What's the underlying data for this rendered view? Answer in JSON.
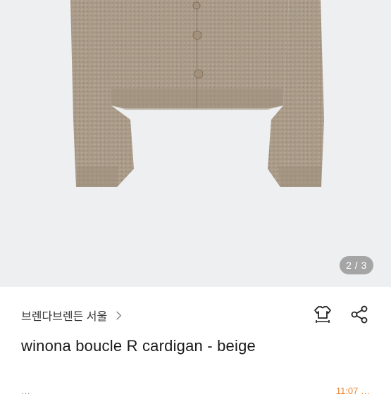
{
  "product_image": {
    "alt_icon": "beige-boucle-cardigan-photo",
    "background_color": "#eeeff0",
    "garment_color": "#a89886"
  },
  "image_counter": {
    "current": "2",
    "separator": "/",
    "total": "3",
    "text": "2 / 3"
  },
  "product": {
    "brand": "브렌다브렌든 서울",
    "title": "winona boucle R cardigan - beige"
  },
  "actions": {
    "size_guide_icon": "shirt-size-icon",
    "share_icon": "share-icon"
  },
  "meta": {
    "seller": "…",
    "time": "11:07 …"
  },
  "colors": {
    "accent_time": "#f0852e",
    "counter_bg": "rgba(120,120,120,0.62)"
  }
}
